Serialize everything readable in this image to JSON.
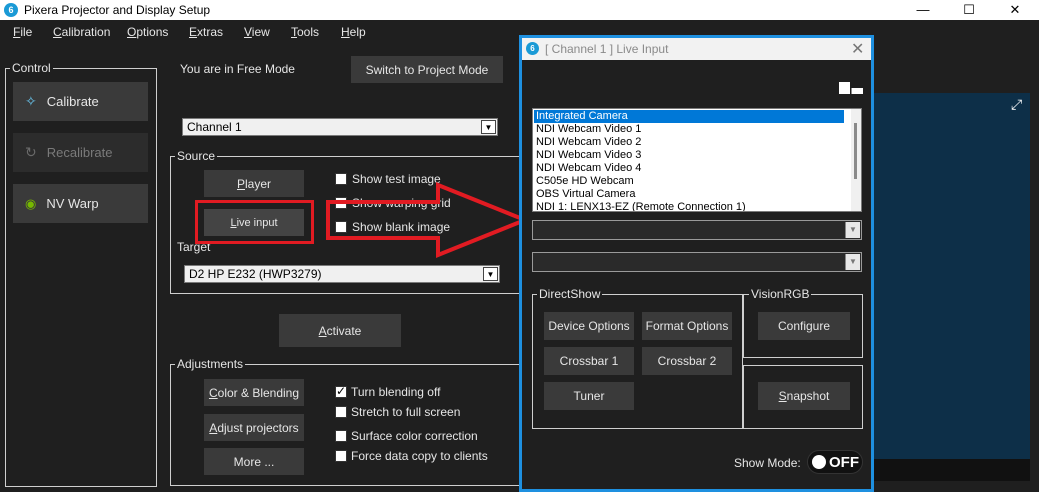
{
  "window": {
    "title": "Pixera Projector and Display Setup",
    "logo_glyph": "6",
    "minimize": "—",
    "maximize": "☐",
    "close": "✕"
  },
  "menu": [
    "File",
    "Calibration",
    "Options",
    "Extras",
    "View",
    "Tools",
    "Help"
  ],
  "control": {
    "label": "Control",
    "calibrate": "Calibrate",
    "recalibrate": "Recalibrate",
    "nv_warp": "NV Warp"
  },
  "mode": {
    "status": "You are in Free Mode",
    "switch_button": "Switch to Project Mode",
    "channel_select": "Channel 1"
  },
  "source": {
    "label": "Source",
    "player": "Player",
    "live_input": "Live input",
    "show_test_image": "Show test image",
    "show_warping_grid": "Show warping grid",
    "show_blank_image": "Show blank image"
  },
  "target": {
    "label": "Target",
    "select": "D2 HP E232 (HWP3279)"
  },
  "activate": "Activate",
  "adjustments": {
    "label": "Adjustments",
    "color_blending": "Color & Blending",
    "adjust_projectors": "Adjust projectors",
    "more": "More ...",
    "turn_blending_off": "Turn blending off",
    "turn_blending_off_checked": true,
    "stretch_full_screen": "Stretch to full screen",
    "surface_color_correction": "Surface color correction",
    "force_data_copy": "Force data copy to clients"
  },
  "dialog": {
    "title": "[ Channel 1 ] Live Input",
    "sources": [
      "Integrated Camera",
      "NDI Webcam Video 1",
      "NDI Webcam Video 2",
      "NDI Webcam Video 3",
      "NDI Webcam Video 4",
      "C505e HD Webcam",
      "OBS Virtual Camera",
      "NDI 1: LENX13-EZ (Remote Connection 1)"
    ],
    "selected_source_index": 0,
    "directshow": {
      "label": "DirectShow",
      "device_options": "Device Options",
      "format_options": "Format Options",
      "crossbar1": "Crossbar 1",
      "crossbar2": "Crossbar 2",
      "tuner": "Tuner"
    },
    "visionrgb": {
      "label": "VisionRGB",
      "configure": "Configure"
    },
    "snapshot": "Snapshot",
    "show_mode_label": "Show Mode:",
    "show_mode_value": "OFF"
  },
  "colors": {
    "accent": "#1e90e0",
    "annotation": "#e11b22",
    "selection": "#0078d7",
    "preview": "#0d2f48"
  }
}
